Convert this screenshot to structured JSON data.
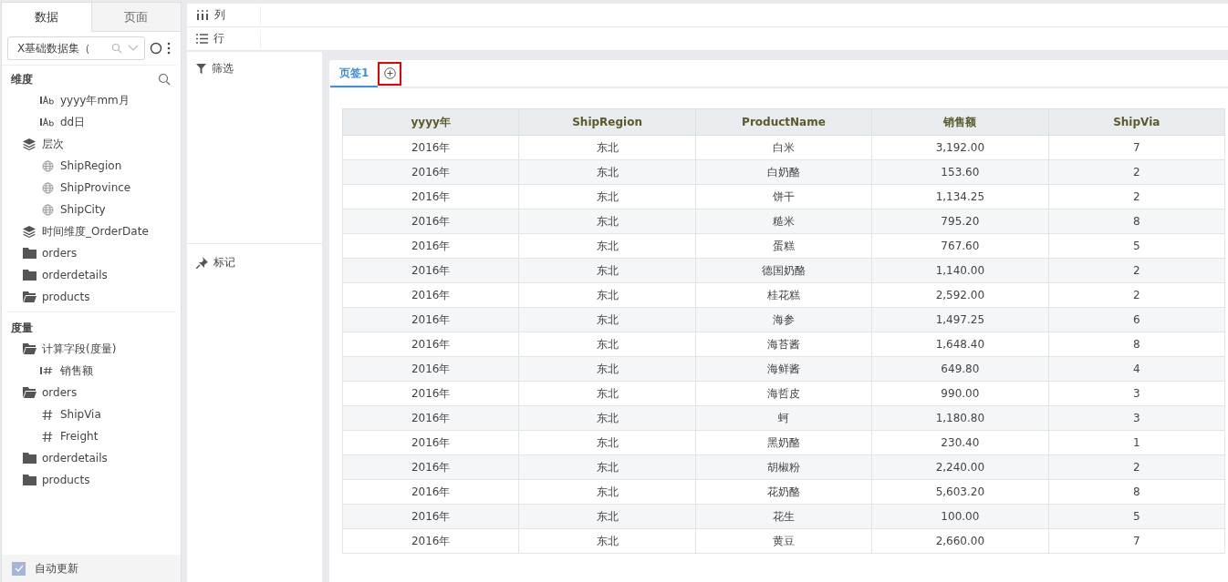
{
  "sidebar": {
    "tabs": [
      {
        "label": "数据",
        "selected": true
      },
      {
        "label": "页面",
        "selected": false
      }
    ],
    "dataset": {
      "value": "X基础数据集（"
    },
    "dimensions": {
      "title": "维度",
      "continued_items": [
        {
          "label": "yyyy年mm月",
          "kind": "text-field"
        },
        {
          "label": "dd日",
          "kind": "text-field"
        }
      ],
      "items": [
        {
          "label": "层次",
          "kind": "hierarchy",
          "children": [
            {
              "label": "ShipRegion",
              "kind": "geo"
            },
            {
              "label": "ShipProvince",
              "kind": "geo"
            },
            {
              "label": "ShipCity",
              "kind": "geo"
            }
          ]
        },
        {
          "label": "时间维度_OrderDate",
          "kind": "hierarchy"
        },
        {
          "label": "orders",
          "kind": "folder"
        },
        {
          "label": "orderdetails",
          "kind": "folder"
        },
        {
          "label": "products",
          "kind": "folder-open"
        }
      ]
    },
    "measures": {
      "title": "度量",
      "items": [
        {
          "label": "计算字段(度量)",
          "kind": "folder-open",
          "children": [
            {
              "label": "销售额",
              "kind": "measure"
            }
          ]
        },
        {
          "label": "orders",
          "kind": "folder-open",
          "children": [
            {
              "label": "ShipVia",
              "kind": "number"
            },
            {
              "label": "Freight",
              "kind": "number"
            }
          ]
        },
        {
          "label": "orderdetails",
          "kind": "folder"
        },
        {
          "label": "products",
          "kind": "folder"
        }
      ]
    },
    "auto_update": {
      "label": "自动更新",
      "checked": true
    }
  },
  "shelves": {
    "columns": "列",
    "rows": "行",
    "filter": "筛选",
    "marks": "标记"
  },
  "page_tabs": [
    {
      "label": "页签1",
      "selected": true
    }
  ],
  "table": {
    "columns": [
      "yyyy年",
      "ShipRegion",
      "ProductName",
      "销售额",
      "ShipVia"
    ],
    "rows": [
      [
        "2016年",
        "东北",
        "白米",
        "3,192.00",
        "7"
      ],
      [
        "2016年",
        "东北",
        "白奶酪",
        "153.60",
        "2"
      ],
      [
        "2016年",
        "东北",
        "饼干",
        "1,134.25",
        "2"
      ],
      [
        "2016年",
        "东北",
        "糙米",
        "795.20",
        "8"
      ],
      [
        "2016年",
        "东北",
        "蛋糕",
        "767.60",
        "5"
      ],
      [
        "2016年",
        "东北",
        "德国奶酪",
        "1,140.00",
        "2"
      ],
      [
        "2016年",
        "东北",
        "桂花糕",
        "2,592.00",
        "2"
      ],
      [
        "2016年",
        "东北",
        "海参",
        "1,497.25",
        "6"
      ],
      [
        "2016年",
        "东北",
        "海苔酱",
        "1,648.40",
        "8"
      ],
      [
        "2016年",
        "东北",
        "海鲜酱",
        "649.80",
        "4"
      ],
      [
        "2016年",
        "东北",
        "海哲皮",
        "990.00",
        "3"
      ],
      [
        "2016年",
        "东北",
        "蚵",
        "1,180.80",
        "3"
      ],
      [
        "2016年",
        "东北",
        "黑奶酪",
        "230.40",
        "1"
      ],
      [
        "2016年",
        "东北",
        "胡椒粉",
        "2,240.00",
        "2"
      ],
      [
        "2016年",
        "东北",
        "花奶酪",
        "5,603.20",
        "8"
      ],
      [
        "2016年",
        "东北",
        "花生",
        "100.00",
        "5"
      ],
      [
        "2016年",
        "东北",
        "黄豆",
        "2,660.00",
        "7"
      ]
    ]
  }
}
